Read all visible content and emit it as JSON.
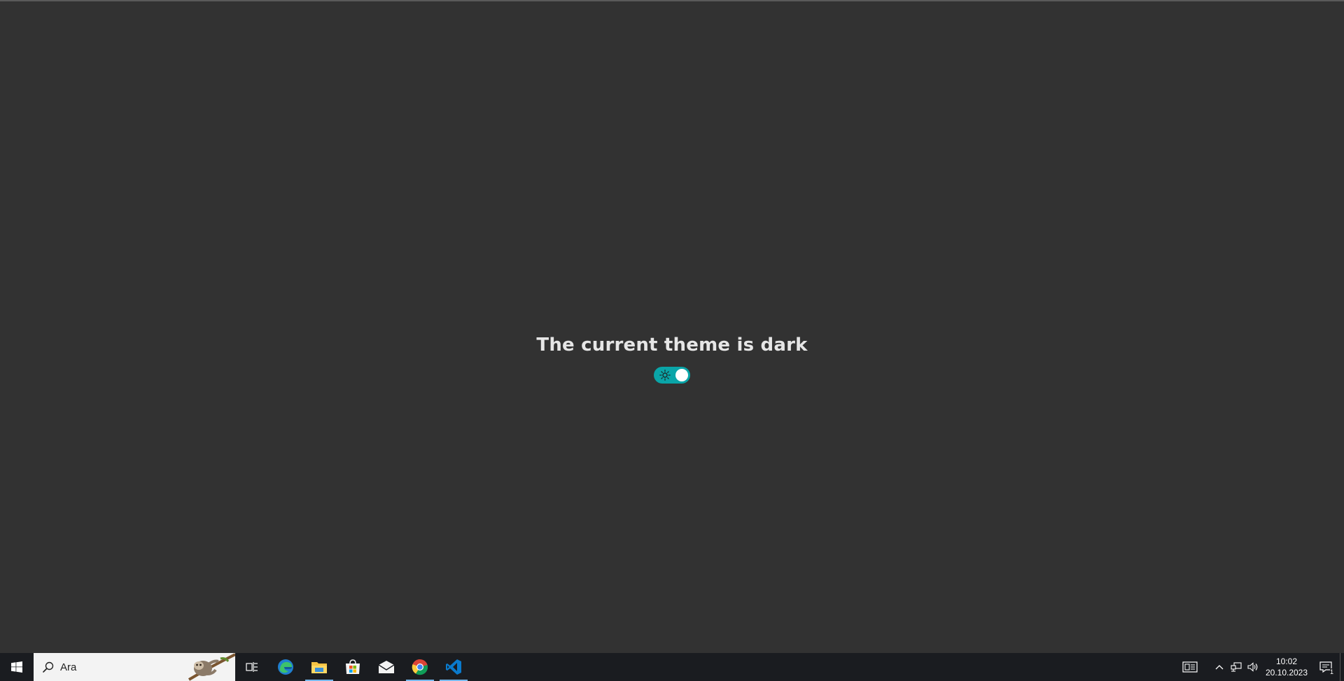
{
  "main": {
    "heading": "The current theme is dark",
    "theme_toggle": {
      "state": "on",
      "icon": "sun-icon",
      "color": "#0aa5a8"
    }
  },
  "taskbar": {
    "start_icon": "windows-logo-icon",
    "search": {
      "value": "Ara",
      "icon": "search-icon",
      "decoration": "sloth-illustration"
    },
    "task_view_icon": "task-view-icon",
    "pinned_apps": [
      {
        "name": "Microsoft Edge",
        "icon": "edge-icon",
        "running": false
      },
      {
        "name": "File Explorer",
        "icon": "folder-icon",
        "running": true
      },
      {
        "name": "Microsoft Store",
        "icon": "store-icon",
        "running": false
      },
      {
        "name": "Mail",
        "icon": "mail-icon",
        "running": false
      },
      {
        "name": "Google Chrome",
        "icon": "chrome-icon",
        "running": true
      },
      {
        "name": "Visual Studio Code",
        "icon": "vscode-icon",
        "running": true
      }
    ],
    "tray": {
      "icons": [
        "news-icon",
        "chevron-up-icon",
        "network-icon",
        "volume-icon"
      ],
      "time": "10:02",
      "date": "20.10.2023",
      "notifications_count": "1"
    },
    "accent_color": "#76b9ed"
  }
}
